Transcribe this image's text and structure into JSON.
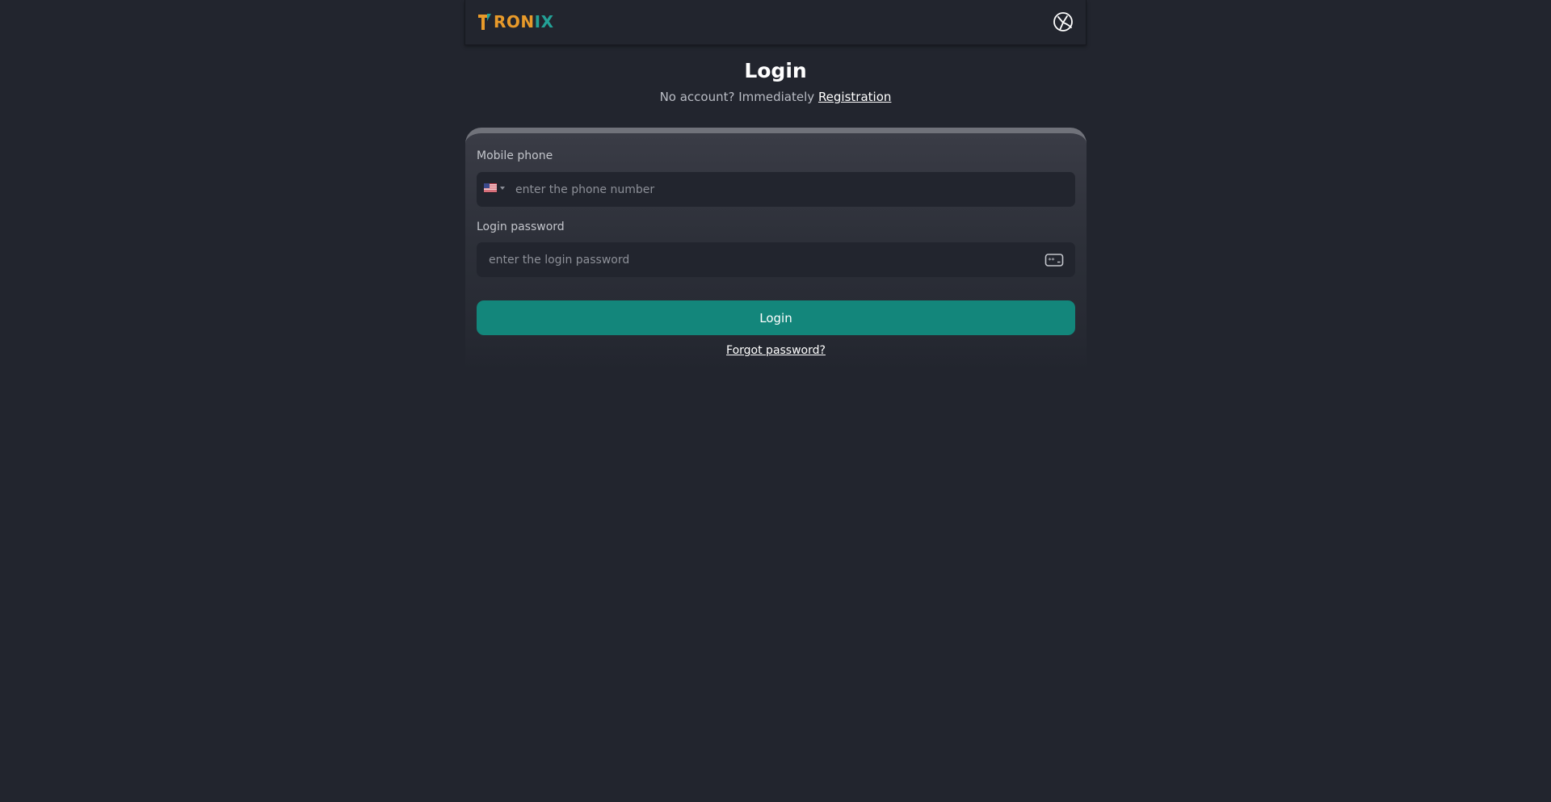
{
  "header": {
    "logo": {
      "text_part1": "RON",
      "text_part2": "IX",
      "brand_color_primary": "#e89a2a",
      "brand_color_secondary": "#23a196",
      "icon": "tronix-logo-icon"
    },
    "language_icon": "globe-icon"
  },
  "login": {
    "title": "Login",
    "no_account_text": "No account? Immediately",
    "registration_link": "Registration",
    "phone": {
      "label": "Mobile phone",
      "country_icon": "us-flag-icon",
      "placeholder": "enter the phone number",
      "value": ""
    },
    "password": {
      "label": "Login password",
      "placeholder": "enter the login password",
      "value": "",
      "toggle_icon": "password-visibility-icon"
    },
    "submit_label": "Login",
    "forgot_link": "Forgot password?"
  },
  "colors": {
    "background": "#22252e",
    "button": "#13867b"
  }
}
